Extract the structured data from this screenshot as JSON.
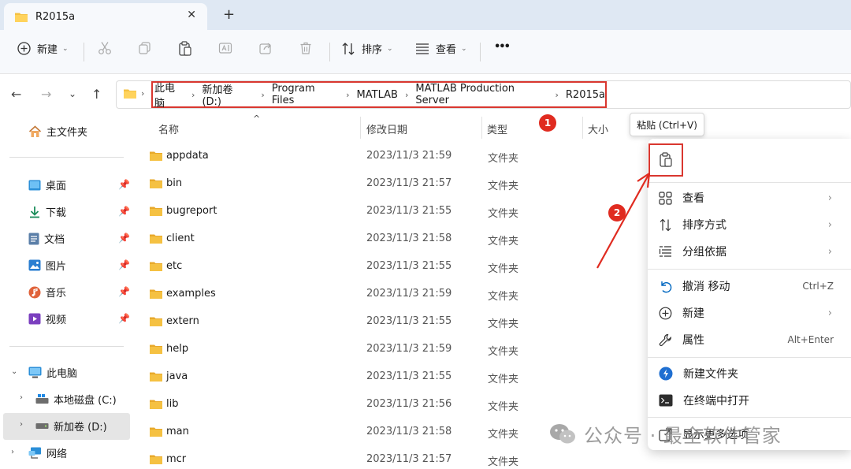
{
  "tab": {
    "title": "R2015a",
    "close": "✕",
    "new_tab": "+"
  },
  "toolbar": {
    "new_label": "新建",
    "sort_label": "排序",
    "view_label": "查看",
    "more": "•••"
  },
  "address": {
    "crumbs": [
      "此电脑",
      "新加卷 (D:)",
      "Program Files",
      "MATLAB",
      "MATLAB Production Server",
      "R2015a"
    ]
  },
  "sidebar": {
    "home": "主文件夹",
    "quick": [
      "桌面",
      "下载",
      "文档",
      "图片",
      "音乐",
      "视频"
    ],
    "this_pc": "此电脑",
    "drives": [
      "本地磁盘 (C:)",
      "新加卷 (D:)"
    ],
    "network": "网络"
  },
  "columns": {
    "name": "名称",
    "date": "修改日期",
    "type": "类型",
    "size": "大小"
  },
  "files": [
    {
      "name": "appdata",
      "date": "2023/11/3 21:59",
      "type": "文件夹"
    },
    {
      "name": "bin",
      "date": "2023/11/3 21:57",
      "type": "文件夹"
    },
    {
      "name": "bugreport",
      "date": "2023/11/3 21:55",
      "type": "文件夹"
    },
    {
      "name": "client",
      "date": "2023/11/3 21:58",
      "type": "文件夹"
    },
    {
      "name": "etc",
      "date": "2023/11/3 21:55",
      "type": "文件夹"
    },
    {
      "name": "examples",
      "date": "2023/11/3 21:59",
      "type": "文件夹"
    },
    {
      "name": "extern",
      "date": "2023/11/3 21:55",
      "type": "文件夹"
    },
    {
      "name": "help",
      "date": "2023/11/3 21:59",
      "type": "文件夹"
    },
    {
      "name": "java",
      "date": "2023/11/3 21:55",
      "type": "文件夹"
    },
    {
      "name": "lib",
      "date": "2023/11/3 21:56",
      "type": "文件夹"
    },
    {
      "name": "man",
      "date": "2023/11/3 21:58",
      "type": "文件夹"
    },
    {
      "name": "mcr",
      "date": "2023/11/3 21:57",
      "type": "文件夹"
    }
  ],
  "context_menu": {
    "tooltip": "粘贴 (Ctrl+V)",
    "view": "查看",
    "sort": "排序方式",
    "group": "分组依据",
    "undo": "撤消 移动",
    "undo_shortcut": "Ctrl+Z",
    "new": "新建",
    "properties": "属性",
    "properties_shortcut": "Alt+Enter",
    "new_folder": "新建文件夹",
    "terminal": "在终端中打开",
    "more_options": "显示更多选项"
  },
  "annotations": {
    "badge1": "1",
    "badge2": "2"
  },
  "watermark": "公众号 · 最全软件管家",
  "colors": {
    "folder": "#f5c142",
    "annotation_red": "#d9372f",
    "accent": "#0067c0"
  }
}
